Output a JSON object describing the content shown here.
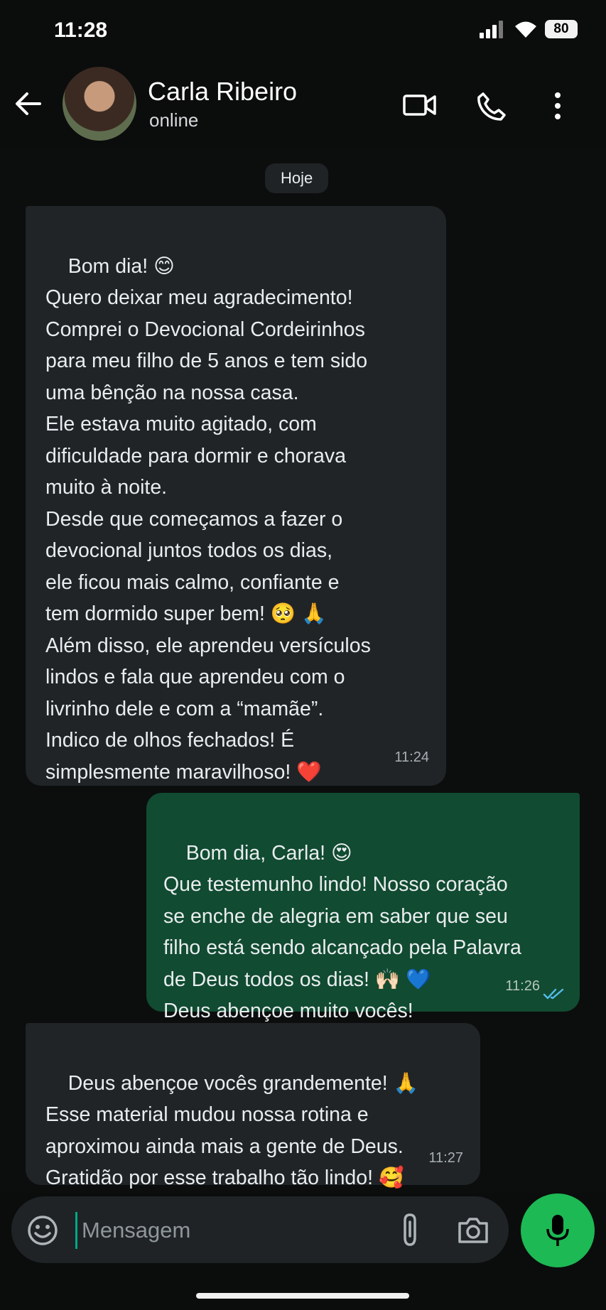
{
  "status_bar": {
    "time": "11:28",
    "battery": "80"
  },
  "header": {
    "name": "Carla Ribeiro",
    "status": "online",
    "icons": [
      "back-arrow-icon",
      "video-call-icon",
      "phone-icon",
      "more-vert-icon"
    ]
  },
  "chat": {
    "date_chip": "Hoje",
    "messages": [
      {
        "direction": "incoming",
        "text": "Bom dia! 😊\nQuero deixar meu agradecimento!\nComprei o Devocional Cordeirinhos\npara meu filho de 5 anos e tem sido\numa bênção na nossa casa.\nEle estava muito agitado, com\ndificuldade para dormir e chorava\nmuito à noite.\nDesde que começamos a fazer o\ndevocional juntos todos os dias,\nele ficou mais calmo, confiante e\ntem dormido super bem! 🥺 🙏\nAlém disso, ele aprendeu versículos\nlindos e fala que aprendeu com o\nlivrinho dele e com a “mamãe”.\nIndico de olhos fechados! É\nsimplesmente maravilhoso! ❤️",
        "time": "11:24"
      },
      {
        "direction": "outgoing",
        "text": "Bom dia, Carla! 😍\nQue testemunho lindo! Nosso coração\nse enche de alegria em saber que seu\nfilho está sendo alcançado pela Palavra\nde Deus todos os dias! 🙌🏻 💙\nDeus abençoe muito vocês!",
        "time": "11:26",
        "read": true
      },
      {
        "direction": "incoming",
        "text": "Deus abençoe vocês grandemente! 🙏\nEsse material mudou nossa rotina e\naproximou ainda mais a gente de Deus.\nGratidão por esse trabalho tão lindo! 🥰",
        "time": "11:27"
      }
    ]
  },
  "composer": {
    "placeholder": "Mensagem"
  },
  "colors": {
    "incoming_bubble": "#202427",
    "outgoing_bubble": "#114b31",
    "mic_button": "#1db954",
    "read_ticks": "#53bdeb"
  }
}
